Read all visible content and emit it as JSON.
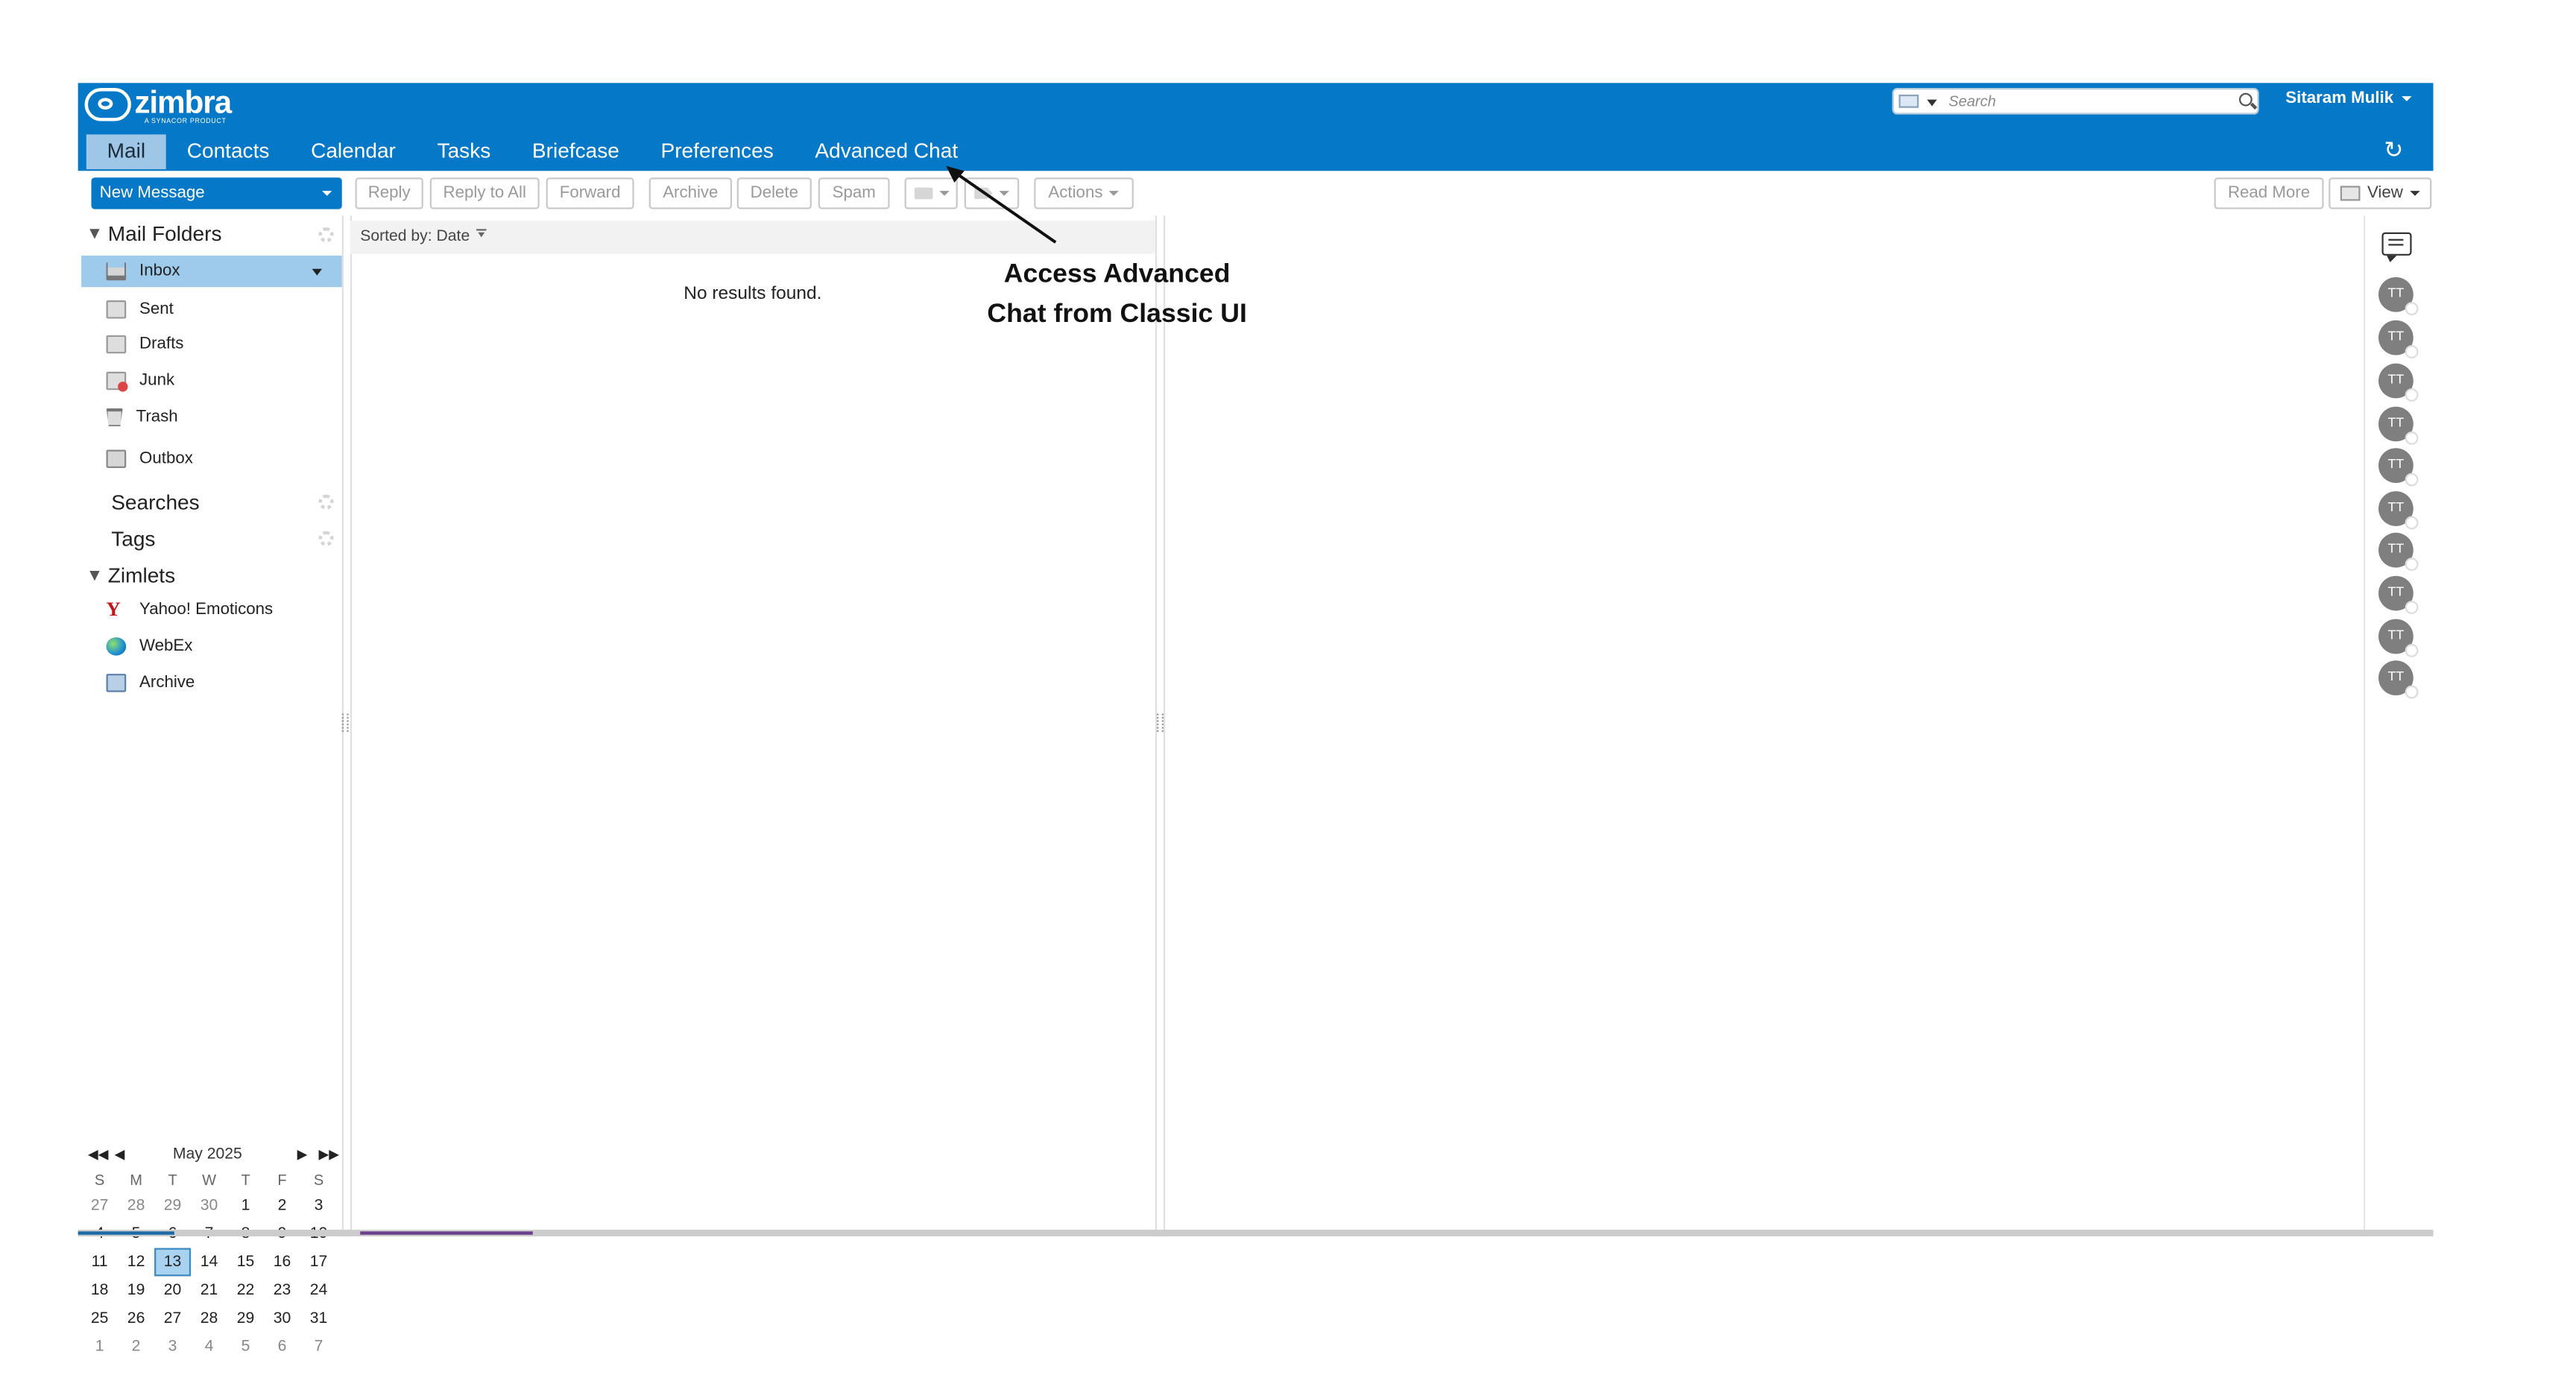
{
  "brand": {
    "name": "zimbra",
    "tagline": "A SYNACOR PRODUCT"
  },
  "search": {
    "placeholder": "Search"
  },
  "user": {
    "name": "Sitaram Mulik"
  },
  "app_tabs": [
    "Mail",
    "Contacts",
    "Calendar",
    "Tasks",
    "Briefcase",
    "Preferences",
    "Advanced Chat"
  ],
  "toolbar": {
    "new_message": "New Message",
    "reply": "Reply",
    "reply_all": "Reply to All",
    "forward": "Forward",
    "archive": "Archive",
    "delete": "Delete",
    "spam": "Spam",
    "actions": "Actions",
    "read_more": "Read More",
    "view": "View"
  },
  "sidebar": {
    "mail_folders": "Mail Folders",
    "folders": [
      "Inbox",
      "Sent",
      "Drafts",
      "Junk",
      "Trash",
      "Outbox"
    ],
    "searches": "Searches",
    "tags": "Tags",
    "zimlets": "Zimlets",
    "zimlet_items": [
      "Yahoo! Emoticons",
      "WebEx",
      "Archive"
    ]
  },
  "list": {
    "sorted_by": "Sorted by: Date",
    "empty": "No results found."
  },
  "calendar": {
    "month": "May 2025",
    "dow": [
      "S",
      "M",
      "T",
      "W",
      "T",
      "F",
      "S"
    ],
    "weeks": [
      [
        "27",
        "28",
        "29",
        "30",
        "1",
        "2",
        "3"
      ],
      [
        "4",
        "5",
        "6",
        "7",
        "8",
        "9",
        "10"
      ],
      [
        "11",
        "12",
        "13",
        "14",
        "15",
        "16",
        "17"
      ],
      [
        "18",
        "19",
        "20",
        "21",
        "22",
        "23",
        "24"
      ],
      [
        "25",
        "26",
        "27",
        "28",
        "29",
        "30",
        "31"
      ],
      [
        "1",
        "2",
        "3",
        "4",
        "5",
        "6",
        "7"
      ]
    ],
    "today": "13"
  },
  "chat_rail": {
    "avatar_initials": "TT",
    "avatar_count": 10
  },
  "annotation": {
    "line1": "Access Advanced",
    "line2": "Chat from Classic UI"
  },
  "colors": {
    "brand_blue": "#0579c7",
    "selected": "#9ecbec"
  }
}
